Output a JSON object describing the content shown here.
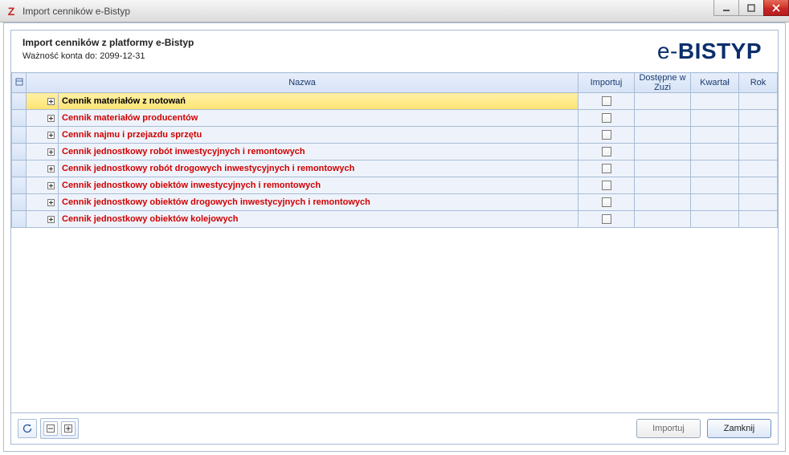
{
  "window": {
    "title": "Import cenników e-Bistyp"
  },
  "header": {
    "heading": "Import cenników z platformy e-Bistyp",
    "validity": "Ważność konta do: 2099-12-31",
    "brand_prefix": "e-",
    "brand_main": "BISTYP"
  },
  "grid": {
    "columns": {
      "nazwa": "Nazwa",
      "importuj": "Importuj",
      "dostepne": "Dostępne w Zuzi",
      "kwartal": "Kwartał",
      "rok": "Rok"
    },
    "rows": [
      {
        "name": "Cennik materiałów z notowań",
        "selected": true
      },
      {
        "name": "Cennik materiałów producentów",
        "selected": false
      },
      {
        "name": "Cennik najmu i przejazdu sprzętu",
        "selected": false
      },
      {
        "name": "Cennik jednostkowy robót inwestycyjnych i remontowych",
        "selected": false
      },
      {
        "name": "Cennik jednostkowy robót drogowych inwestycyjnych i remontowych",
        "selected": false
      },
      {
        "name": "Cennik jednostkowy obiektów inwestycyjnych i remontowych",
        "selected": false
      },
      {
        "name": "Cennik jednostkowy obiektów drogowych inwestycyjnych i remontowych",
        "selected": false
      },
      {
        "name": "Cennik jednostkowy obiektów kolejowych",
        "selected": false
      }
    ]
  },
  "footer": {
    "import_label": "Importuj",
    "close_label": "Zamknij"
  }
}
